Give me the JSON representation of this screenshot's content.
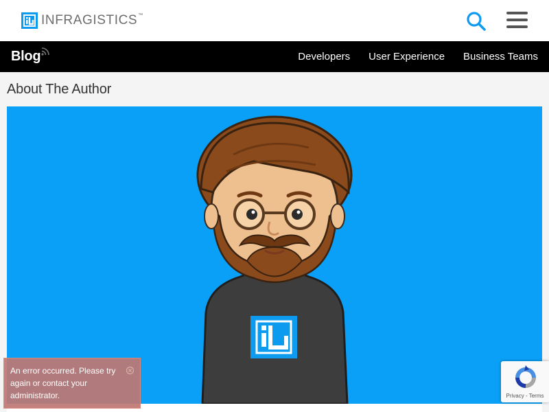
{
  "header": {
    "logo_text": "INFRAGISTICS",
    "logo_trademark": "™",
    "brand_color": "#0d9bf0"
  },
  "navbar": {
    "blog_label": "Blog",
    "links": [
      "Developers",
      "User Experience",
      "Business Teams"
    ]
  },
  "main": {
    "section_title": "About The Author",
    "image_bg_color": "#0aa0f7"
  },
  "error_toast": {
    "message": "An error occurred. Please try again or contact your administrator."
  },
  "recaptcha": {
    "privacy_label": "Privacy",
    "separator": " - ",
    "terms_label": "Terms"
  }
}
